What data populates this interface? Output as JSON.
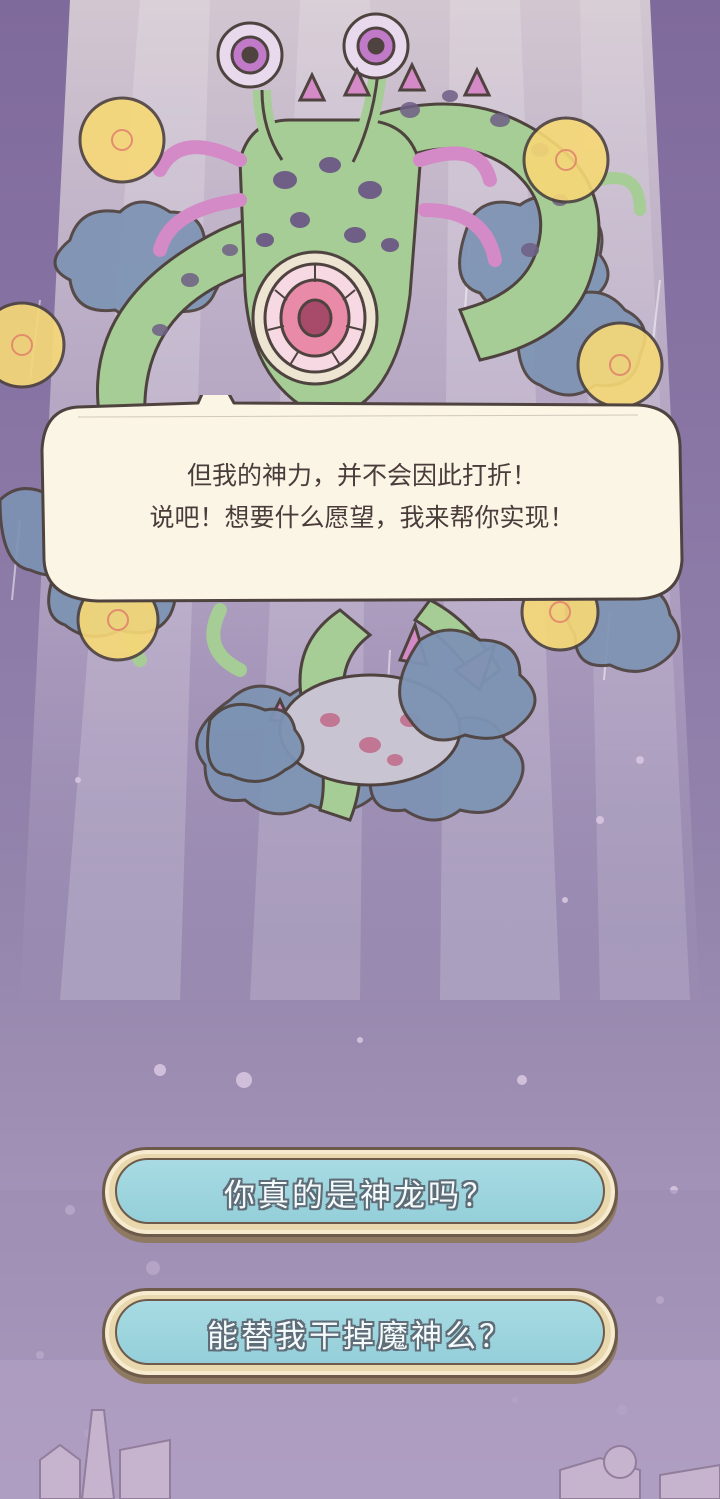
{
  "dialog": {
    "line1": "但我的神力，并不会因此打折！",
    "line2": "说吧！想要什么愿望，我来帮你实现！"
  },
  "choices": [
    {
      "label": "你真的是神龙吗？"
    },
    {
      "label": "能替我干掉魔神么？"
    }
  ],
  "colors": {
    "background": "#8b78a6",
    "bubble_fill": "#fbf5e6",
    "bubble_outline": "#4f4340",
    "button_face": "#9fd6df",
    "button_rim": "#e9d7ae",
    "monster_body": "#9fc690",
    "monster_spots": "#6f5f86",
    "clouds": "#7d93b3",
    "orbs": "#f7d976"
  }
}
